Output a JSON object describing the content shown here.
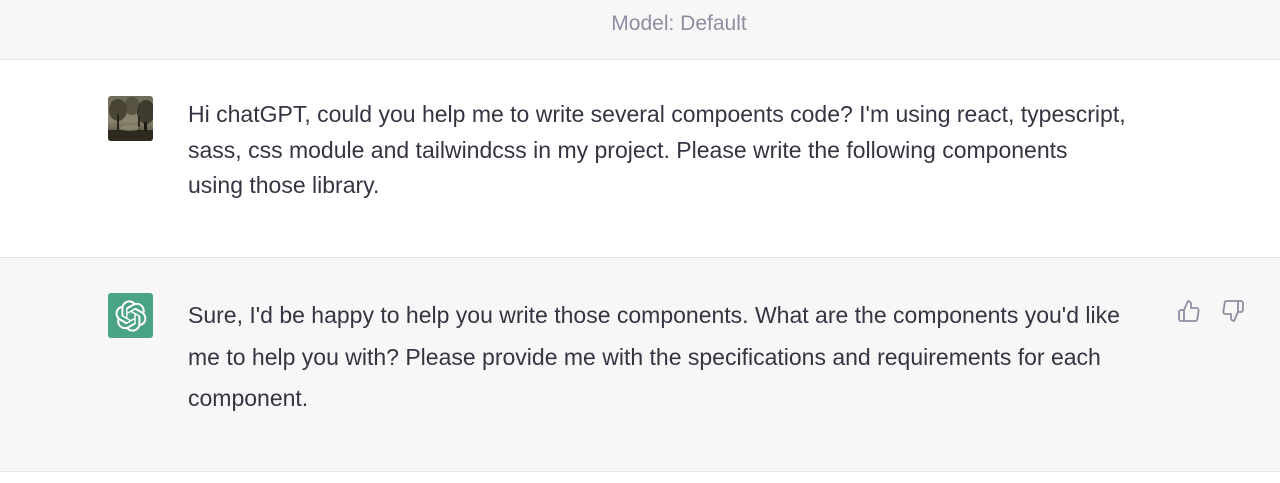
{
  "header": {
    "model_label": "Model: Default"
  },
  "conversation": {
    "user_message": "Hi chatGPT, could you help me to write several compoents code? I'm using react, typescript, sass, css module and tailwindcss in my project. Please write the following components using those library.",
    "assistant_message": "Sure, I'd be happy to help you write those components. What are the components you'd like me to help you with? Please provide me with the specifications and requirements for each component."
  },
  "icons": {
    "user_avatar": "user-avatar-photo",
    "assistant_avatar": "openai-logo-icon",
    "thumbs_up": "thumbs-up-icon",
    "thumbs_down": "thumbs-down-icon"
  },
  "colors": {
    "assistant_avatar_bg": "#4aa383",
    "assistant_row_bg": "#f7f7f8",
    "text": "#343541",
    "muted": "#8e8ea0"
  }
}
